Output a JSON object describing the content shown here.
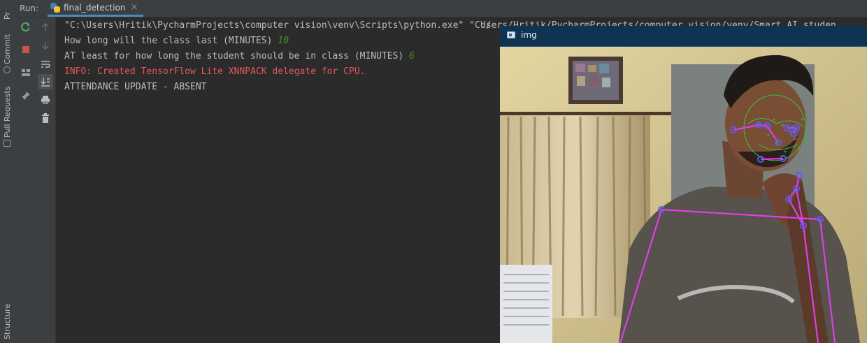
{
  "side_tabs": [
    "Pr",
    "Commit",
    "Pull Requests",
    "Structure"
  ],
  "run_header": {
    "label": "Run:",
    "tab_name": "final_detection",
    "tab_close": "×"
  },
  "console_lines": [
    {
      "text": "\"C:\\Users\\Hritik\\PycharmProjects\\computer vision\\venv\\Scripts\\python.exe\" \"C:/"
    },
    {
      "prompt": "How long will the class last (MINUTES) ",
      "input": "10"
    },
    {
      "prompt": "AT least for how long the student should be in class (MINUTES) ",
      "input": "6"
    },
    {
      "text": "INFO: Created TensorFlow Lite XNNPACK delegate for CPU."
    },
    {
      "text": "ATTENDANCE UPDATE - ABSENT"
    }
  ],
  "command_tail": "Users/Hritik/PycharmProjects/computer vision/venv/Smart AI studen",
  "image_window": {
    "title": "img",
    "icon": "image-window-icon"
  },
  "colors": {
    "pose": "#e03ee8",
    "landmark": "#5a5cf0",
    "face_mesh": "#2fc94a",
    "console_red": "#e0575c",
    "console_green": "#4e8a2e"
  }
}
